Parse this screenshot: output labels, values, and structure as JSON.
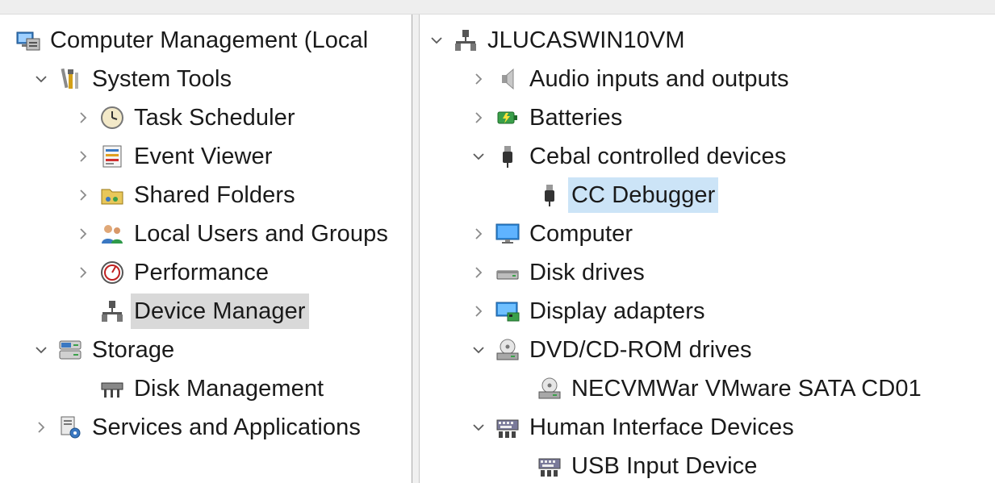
{
  "left_tree": [
    {
      "label": "Computer Management (Local",
      "icon": "computer-management-icon",
      "depth": 0,
      "chevron": "none",
      "selected": false
    },
    {
      "label": "System Tools",
      "icon": "system-tools-icon",
      "depth": 1,
      "chevron": "down",
      "selected": false
    },
    {
      "label": "Task Scheduler",
      "icon": "clock-icon",
      "depth": 2,
      "chevron": "right",
      "selected": false
    },
    {
      "label": "Event Viewer",
      "icon": "event-viewer-icon",
      "depth": 2,
      "chevron": "right",
      "selected": false
    },
    {
      "label": "Shared Folders",
      "icon": "shared-folders-icon",
      "depth": 2,
      "chevron": "right",
      "selected": false
    },
    {
      "label": "Local Users and Groups",
      "icon": "users-icon",
      "depth": 2,
      "chevron": "right",
      "selected": false
    },
    {
      "label": "Performance",
      "icon": "performance-icon",
      "depth": 2,
      "chevron": "right",
      "selected": false
    },
    {
      "label": "Device Manager",
      "icon": "device-manager-icon",
      "depth": 2,
      "chevron": "none",
      "selected": true
    },
    {
      "label": "Storage",
      "icon": "storage-icon",
      "depth": 1,
      "chevron": "down",
      "selected": false
    },
    {
      "label": "Disk Management",
      "icon": "disk-management-icon",
      "depth": 2,
      "chevron": "none",
      "selected": false
    },
    {
      "label": "Services and Applications",
      "icon": "services-icon",
      "depth": 1,
      "chevron": "right",
      "selected": false
    }
  ],
  "device_tree": [
    {
      "label": "JLUCASWIN10VM",
      "icon": "computer-network-icon",
      "depth": 0,
      "chevron": "down",
      "selected": false
    },
    {
      "label": "Audio inputs and outputs",
      "icon": "speaker-icon",
      "depth": 1,
      "chevron": "right",
      "selected": false
    },
    {
      "label": "Batteries",
      "icon": "battery-icon",
      "depth": 1,
      "chevron": "right",
      "selected": false
    },
    {
      "label": "Cebal controlled devices",
      "icon": "usb-plug-icon",
      "depth": 1,
      "chevron": "down",
      "selected": false
    },
    {
      "label": "CC Debugger",
      "icon": "usb-plug-icon",
      "depth": 2,
      "chevron": "none",
      "selected": true
    },
    {
      "label": "Computer",
      "icon": "monitor-icon",
      "depth": 1,
      "chevron": "right",
      "selected": false
    },
    {
      "label": "Disk drives",
      "icon": "disk-drive-icon",
      "depth": 1,
      "chevron": "right",
      "selected": false
    },
    {
      "label": "Display adapters",
      "icon": "display-adapter-icon",
      "depth": 1,
      "chevron": "right",
      "selected": false
    },
    {
      "label": "DVD/CD-ROM drives",
      "icon": "cd-drive-icon",
      "depth": 1,
      "chevron": "down",
      "selected": false
    },
    {
      "label": "NECVMWar VMware SATA CD01",
      "icon": "cd-drive-icon",
      "depth": 2,
      "chevron": "none",
      "selected": false
    },
    {
      "label": "Human Interface Devices",
      "icon": "hid-keyboard-icon",
      "depth": 1,
      "chevron": "down",
      "selected": false
    },
    {
      "label": "USB Input Device",
      "icon": "hid-keyboard-icon",
      "depth": 2,
      "chevron": "none",
      "selected": false
    }
  ],
  "colors": {
    "selection_gray": "#d9d9d9",
    "selection_blue": "#cce4f7",
    "chevron": "#5a5a5a"
  }
}
